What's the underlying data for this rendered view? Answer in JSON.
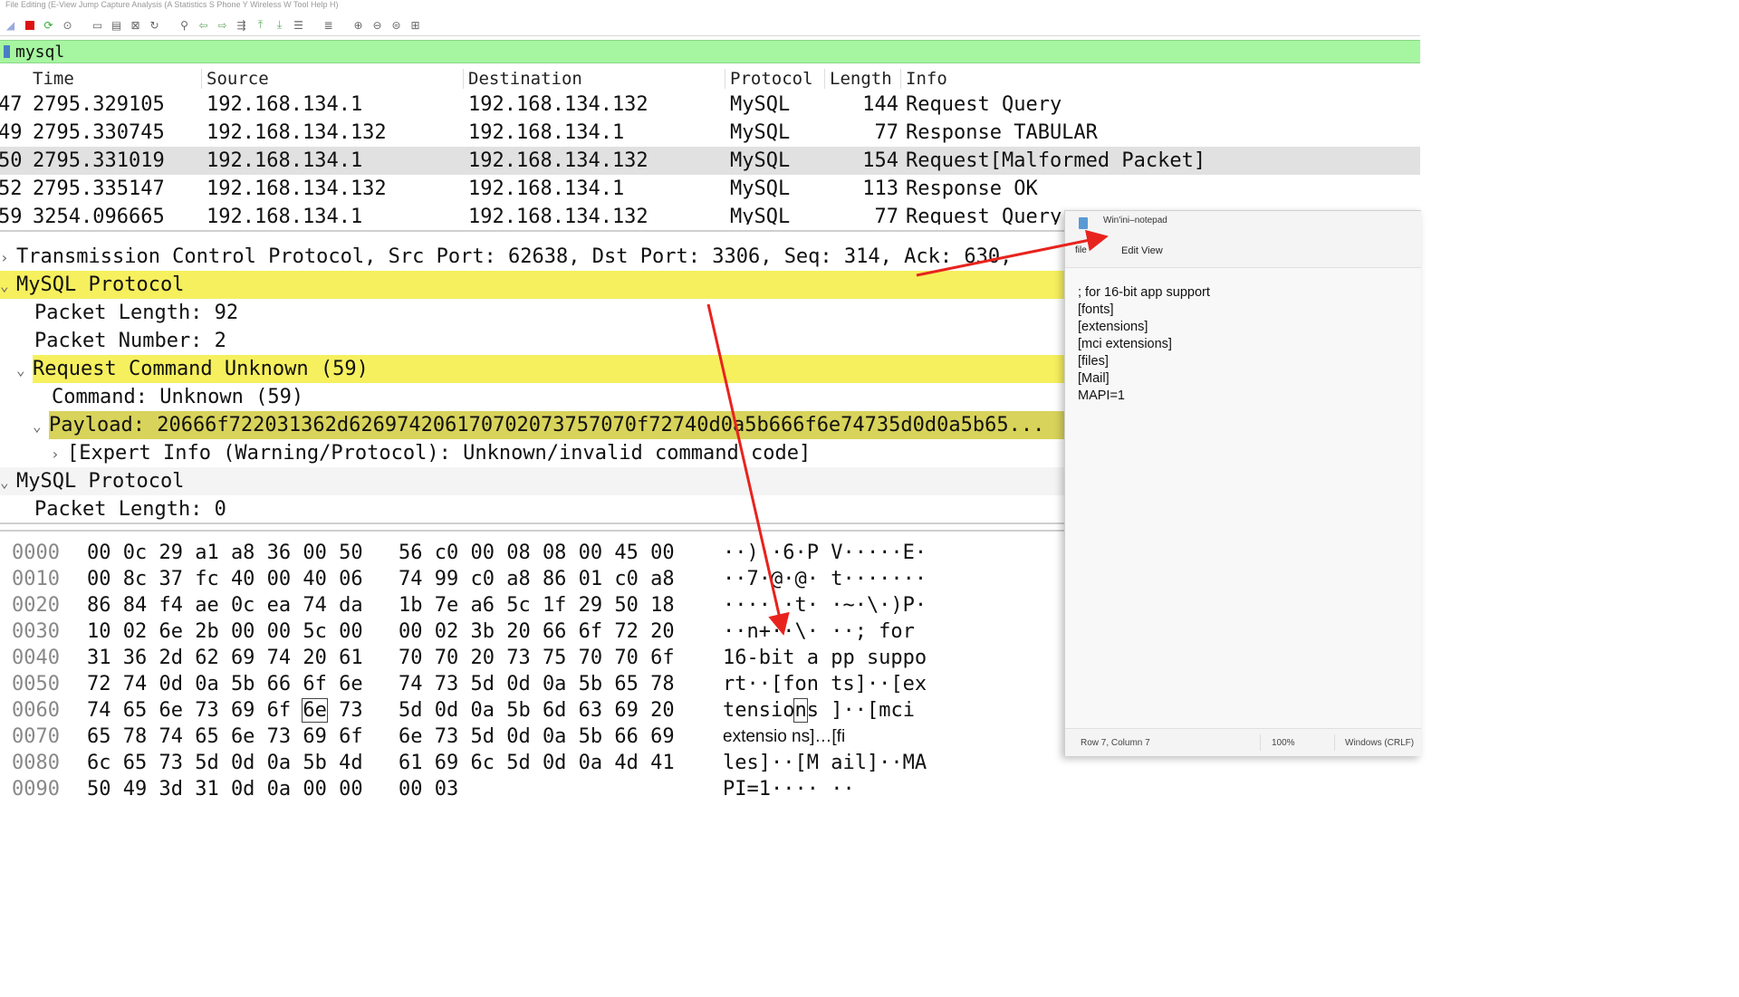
{
  "menubar": {
    "text": "File Editing (E-View Jump Capture Analysis (A Statistics S Phone Y Wireless W Tool Help H)"
  },
  "toolbar": {
    "icons": [
      "shark-fin-start-icon",
      "stop-capture-icon",
      "restart-capture-icon",
      "capture-options-icon",
      "open-file-icon",
      "save-file-icon",
      "close-file-icon",
      "reload-file-icon",
      "find-packet-icon",
      "go-back-icon",
      "go-forward-icon",
      "go-to-packet-icon",
      "go-first-icon",
      "go-last-icon",
      "auto-scroll-icon",
      "colorize-icon",
      "zoom-in-icon",
      "zoom-out-icon",
      "zoom-normal-icon",
      "resize-columns-icon"
    ]
  },
  "filter": {
    "value": "mysql"
  },
  "packet_list": {
    "headers": {
      "time": "Time",
      "source": "Source",
      "destination": "Destination",
      "protocol": "Protocol",
      "length": "Length",
      "info": "Info"
    },
    "rows": [
      {
        "no": "47",
        "time": "2795.329105",
        "source": "192.168.134.1",
        "destination": "192.168.134.132",
        "protocol": "MySQL",
        "length": "144",
        "info": "Request Query"
      },
      {
        "no": "49",
        "time": "2795.330745",
        "source": "192.168.134.132",
        "destination": "192.168.134.1",
        "protocol": "MySQL",
        "length": "77",
        "info": "Response TABULAR"
      },
      {
        "no": "50",
        "time": "2795.331019",
        "source": "192.168.134.1",
        "destination": "192.168.134.132",
        "protocol": "MySQL",
        "length": "154",
        "info": "Request[Malformed Packet]"
      },
      {
        "no": "52",
        "time": "2795.335147",
        "source": "192.168.134.132",
        "destination": "192.168.134.1",
        "protocol": "MySQL",
        "length": "113",
        "info": "Response OK"
      },
      {
        "no": "59",
        "time": "3254.096665",
        "source": "192.168.134.1",
        "destination": "192.168.134.132",
        "protocol": "MySQL",
        "length": "77",
        "info": "Request Query"
      }
    ]
  },
  "details": {
    "tcp": "Transmission Control Protocol, Src Port: 62638, Dst Port: 3306, Seq: 314, Ack: 630,",
    "mysql1": "MySQL Protocol",
    "packet_length": "Packet Length: 92",
    "packet_number": "Packet Number: 2",
    "request_command": "Request Command Unknown (59)",
    "command": "Command: Unknown (59)",
    "payload": "Payload: 20666f722031362d626974206170702073757070f72740d0a5b666f6e74735d0d0a5b65...",
    "expert_info": "[Expert Info (Warning/Protocol): Unknown/invalid command code]",
    "mysql2": "MySQL Protocol",
    "packet_length2": "Packet Length: 0"
  },
  "hex": [
    {
      "off": "0000",
      "b1": "00 0c 29 a1 a8 36 00 50",
      "b2": "56 c0 00 08 08 00 45 00",
      "ascii": "··)··6·P V·····E·"
    },
    {
      "off": "0010",
      "b1": "00 8c 37 fc 40 00 40 06",
      "b2": "74 99 c0 a8 86 01 c0 a8",
      "ascii": "··7·@·@· t·······"
    },
    {
      "off": "0020",
      "b1": "86 84 f4 ae 0c ea 74 da",
      "b2": "1b 7e a6 5c 1f 29 50 18",
      "ascii": "······t· ·~·\\·)P·"
    },
    {
      "off": "0030",
      "b1": "10 02 6e 2b 00 00 5c 00",
      "b2": "00 02 3b 20 66 6f 72 20",
      "ascii": "··n+··\\· ··; for "
    },
    {
      "off": "0040",
      "b1": "31 36 2d 62 69 74 20 61",
      "b2": "70 70 20 73 75 70 70 6f",
      "ascii": "16-bit a pp suppo"
    },
    {
      "off": "0050",
      "b1": "72 74 0d 0a 5b 66 6f 6e",
      "b2": "74 73 5d 0d 0a 5b 65 78",
      "ascii": "rt··[fon ts]··[ex"
    },
    {
      "off": "0060",
      "b1": "74 65 6e 73 69 6f",
      "b1_hl": "6e",
      "b1_tail": "73",
      "b2": "5d 0d 0a 5b 6d 63 69 20",
      "ascii_a": "tensio",
      "ascii_hl": "n",
      "ascii_b": "s ]··[mci"
    },
    {
      "off": "0070",
      "b1": "65 78 74 65 6e 73 69 6f",
      "b2": "6e 73 5d 0d 0a 5b 66 69",
      "ascii": "extensio ns]…[fi"
    },
    {
      "off": "0080",
      "b1": "6c 65 73 5d 0d 0a 5b 4d",
      "b2": "61 69 6c 5d 0d 0a 4d 41",
      "ascii": "les]··[M ail]··MA"
    },
    {
      "off": "0090",
      "b1": "50 49 3d 31 0d 0a 00 00",
      "b2": "00 03",
      "ascii": "PI=1···· ··"
    }
  ],
  "notepad": {
    "title": "Win'ini–notepad",
    "menu_file": "file",
    "menu_edit_view": "Edit View",
    "lines": [
      "; for 16-bit app support",
      "[fonts]",
      "[extensions]",
      "[mci extensions]",
      "[files]",
      "[Mail]",
      "MAPI=1"
    ],
    "status_pos": "Row 7, Column 7",
    "status_zoom": "100%",
    "status_eol": "Windows (CRLF)"
  },
  "colors": {
    "filter_bg": "#a6f5a0",
    "highlight_yellow": "#f6f05e",
    "arrow": "#e8231e"
  }
}
